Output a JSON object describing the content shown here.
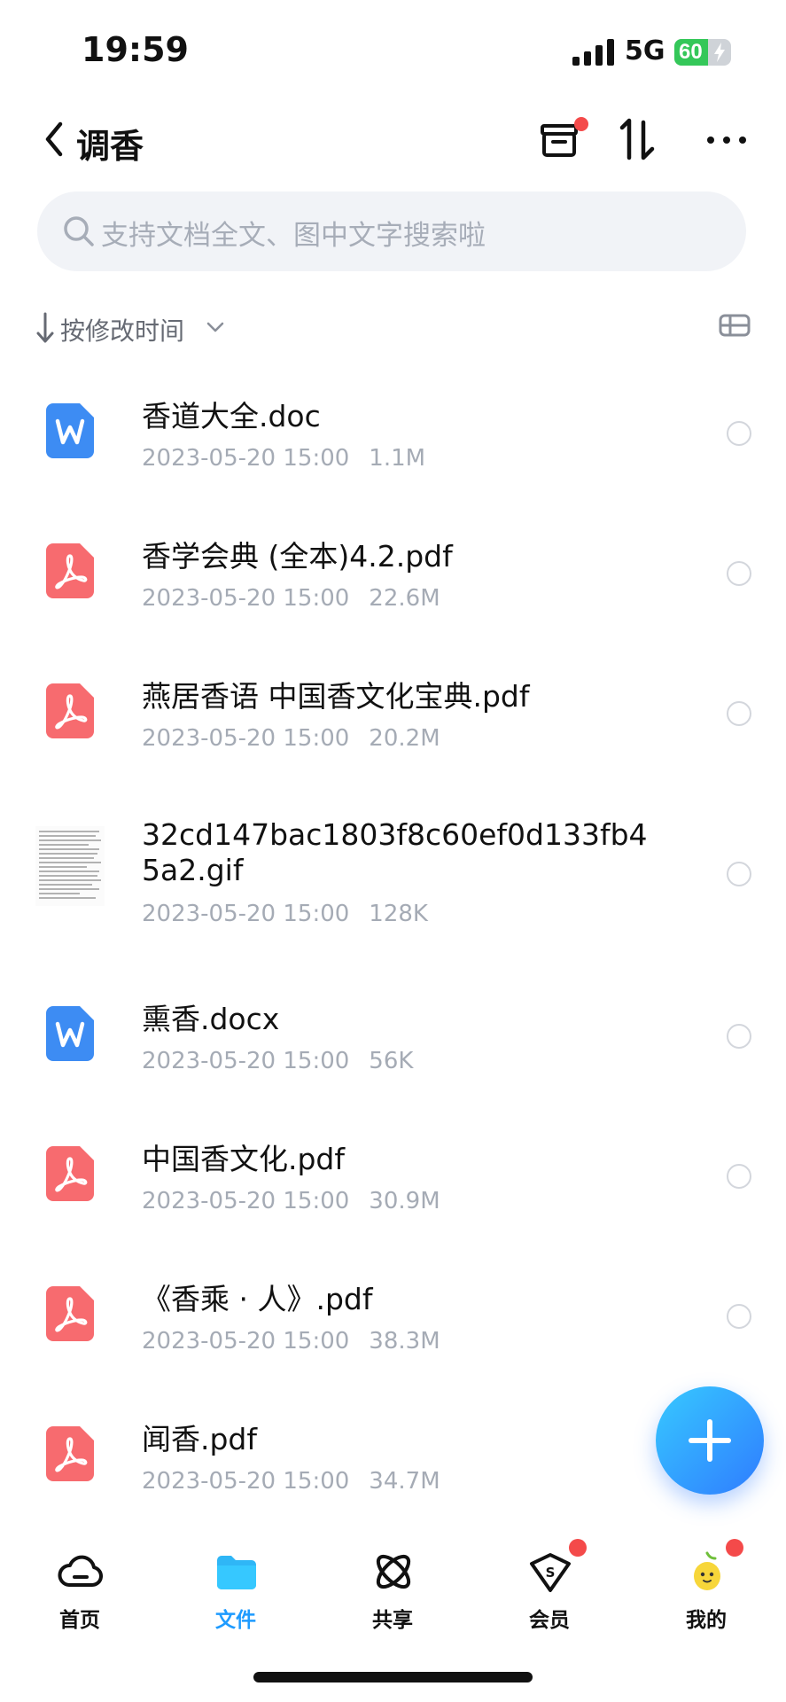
{
  "status_bar": {
    "time": "19:59",
    "network": "5G",
    "battery_percent": "60",
    "battery_level": 0.6,
    "battery_color": "#34c759"
  },
  "nav": {
    "back_icon": "chevron-left-icon",
    "title": "调香",
    "actions": [
      "archive-box-icon",
      "sort-arrows-icon",
      "more-icon"
    ]
  },
  "search": {
    "placeholder": "支持文档全文、图中文字搜索啦"
  },
  "sort": {
    "label": "按修改时间"
  },
  "files": [
    {
      "name": "香道大全.doc",
      "date": "2023-05-20 15:00",
      "size": "1.1M",
      "type": "word"
    },
    {
      "name": "香学会典 (全本)4.2.pdf",
      "date": "2023-05-20 15:00",
      "size": "22.6M",
      "type": "pdf"
    },
    {
      "name": "燕居香语 中国香文化宝典.pdf",
      "date": "2023-05-20 15:00",
      "size": "20.2M",
      "type": "pdf"
    },
    {
      "name": "32cd147bac1803f8c60ef0d133fb45a2.gif",
      "date": "2023-05-20 15:00",
      "size": "128K",
      "type": "image"
    },
    {
      "name": "熏香.docx",
      "date": "2023-05-20 15:00",
      "size": "56K",
      "type": "word"
    },
    {
      "name": "中国香文化.pdf",
      "date": "2023-05-20 15:00",
      "size": "30.9M",
      "type": "pdf"
    },
    {
      "name": "《香乘 · 人》.pdf",
      "date": "2023-05-20 15:00",
      "size": "38.3M",
      "type": "pdf"
    },
    {
      "name": "闻香.pdf",
      "date": "2023-05-20 15:00",
      "size": "34.7M",
      "type": "pdf"
    }
  ],
  "tabs": [
    {
      "label": "首页",
      "icon": "cloud-icon"
    },
    {
      "label": "文件",
      "icon": "folder-icon"
    },
    {
      "label": "共享",
      "icon": "atom-icon"
    },
    {
      "label": "会员",
      "icon": "vip-diamond-icon"
    },
    {
      "label": "我的",
      "icon": "avatar-icon"
    }
  ],
  "colors": {
    "accent": "#1e9bff",
    "pdf": "#f76b6f",
    "word": "#3d8cf3",
    "badge": "#f44a4a"
  }
}
